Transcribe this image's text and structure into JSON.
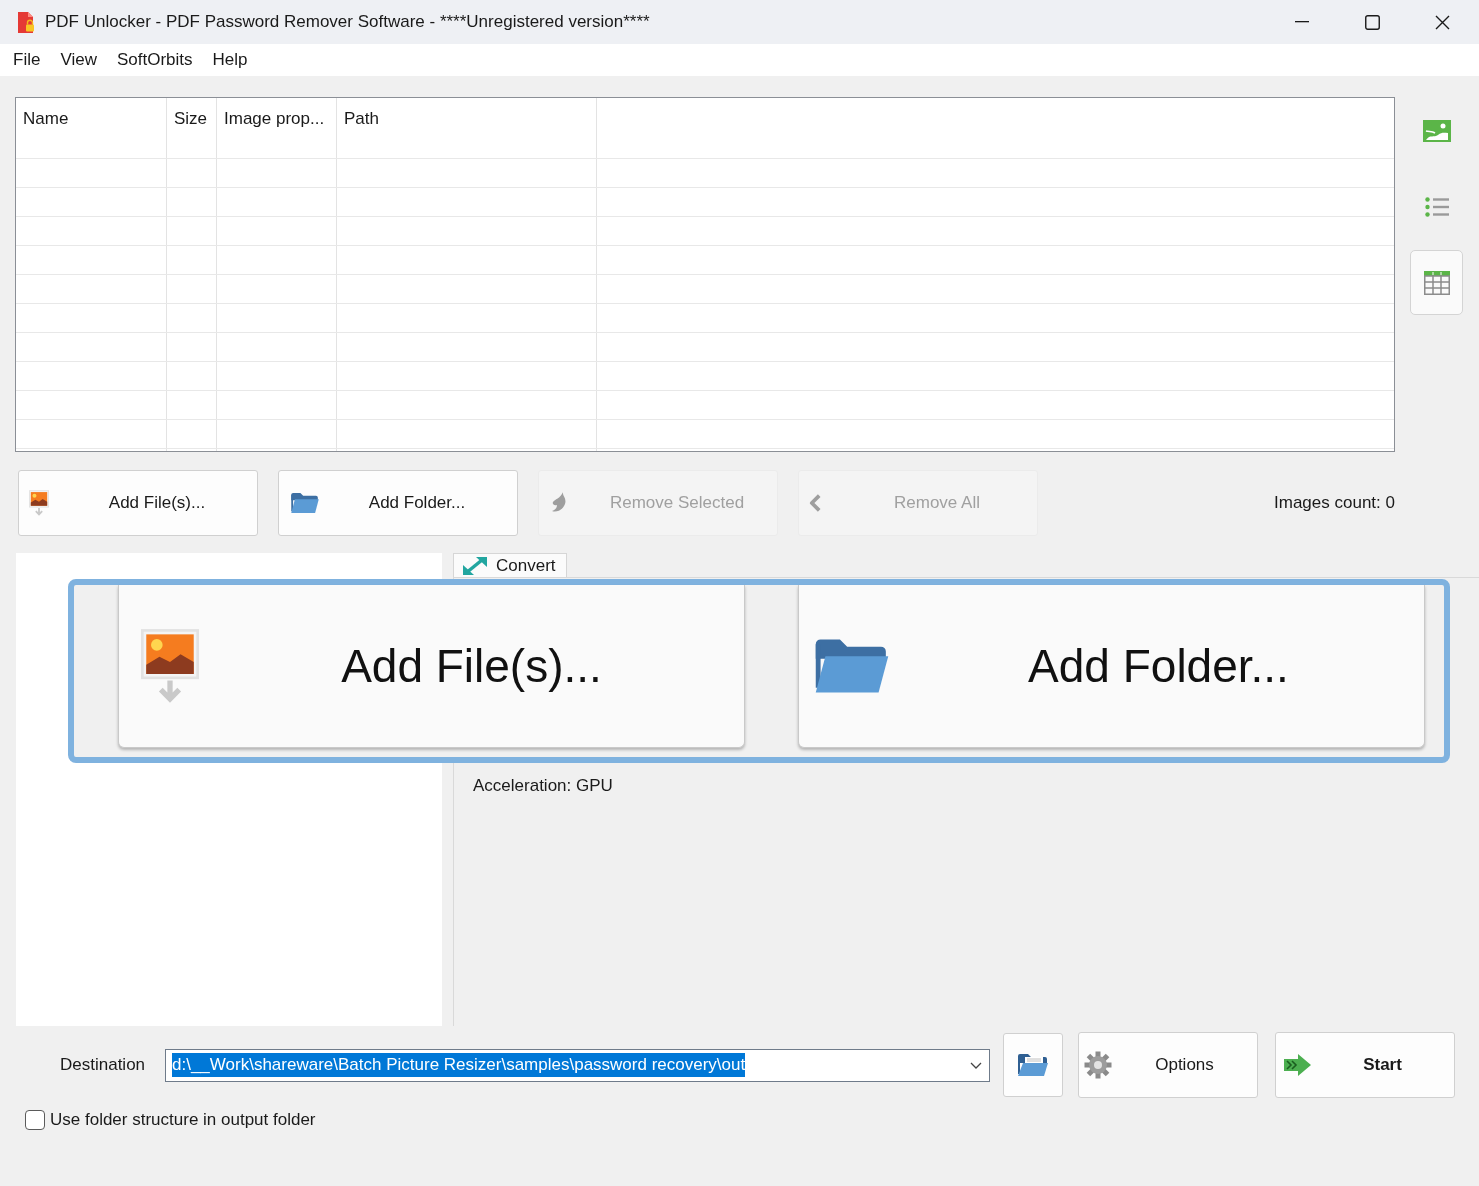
{
  "window": {
    "title": "PDF Unlocker - PDF Password Remover Software - ****Unregistered version****"
  },
  "menu": [
    "File",
    "View",
    "SoftOrbits",
    "Help"
  ],
  "file_list": {
    "columns": [
      "Name",
      "Size",
      "Image prop...",
      "Path"
    ]
  },
  "view_buttons": [
    {
      "kind": "thumbnails",
      "selected": false
    },
    {
      "kind": "list",
      "selected": false
    },
    {
      "kind": "table",
      "selected": true
    }
  ],
  "toolbar": {
    "buttons": [
      {
        "kind": "add_files",
        "label": "Add File(s)...",
        "disabled": false
      },
      {
        "kind": "add_folder",
        "label": "Add Folder...",
        "disabled": false
      },
      {
        "kind": "remove_selected",
        "label": "Remove Selected",
        "disabled": true
      },
      {
        "kind": "remove_all",
        "label": "Remove All",
        "disabled": true
      }
    ],
    "images_count": "Images count: 0"
  },
  "tabs": [
    {
      "label": "Convert",
      "selected": true
    }
  ],
  "convert_panel": {
    "acceleration": "Acceleration: GPU"
  },
  "callout": {
    "buttons": [
      {
        "kind": "add_files",
        "label": "Add File(s)..."
      },
      {
        "kind": "add_folder",
        "label": "Add Folder..."
      }
    ]
  },
  "destination": {
    "label": "Destination",
    "value": "d:\\__Work\\shareware\\Batch Picture Resizer\\samples\\password recovery\\out",
    "value_selected": true
  },
  "actions": [
    {
      "kind": "browse"
    },
    {
      "kind": "options",
      "label": "Options"
    },
    {
      "kind": "start",
      "label": "Start"
    }
  ],
  "use_folder_structure": {
    "label": "Use folder structure in output folder",
    "checked": false
  }
}
